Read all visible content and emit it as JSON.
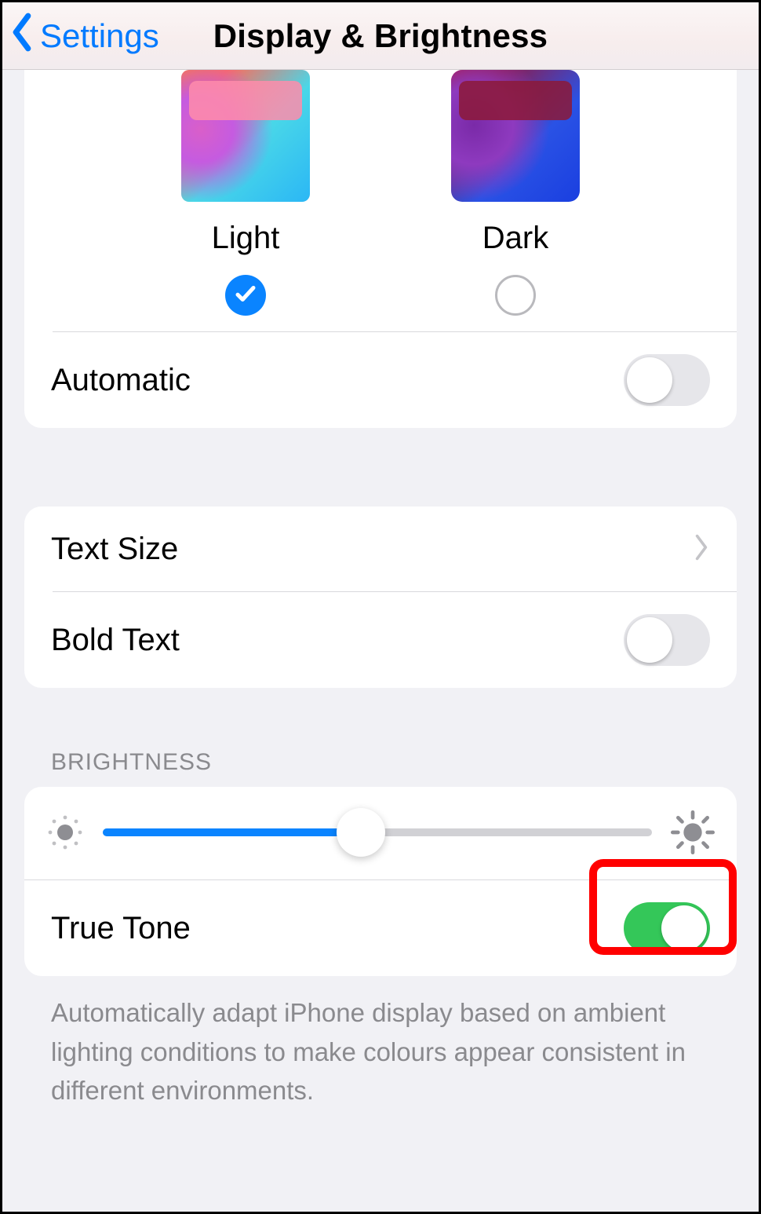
{
  "header": {
    "back_label": "Settings",
    "title": "Display & Brightness"
  },
  "appearance": {
    "light_label": "Light",
    "dark_label": "Dark",
    "selected": "light",
    "automatic_label": "Automatic",
    "automatic_on": false
  },
  "text": {
    "text_size_label": "Text Size",
    "bold_text_label": "Bold Text",
    "bold_text_on": false
  },
  "brightness": {
    "section_label": "BRIGHTNESS",
    "value_percent": 47,
    "true_tone_label": "True Tone",
    "true_tone_on": true,
    "footer": "Automatically adapt iPhone display based on ambient lighting conditions to make colours appear consistent in different environments."
  }
}
